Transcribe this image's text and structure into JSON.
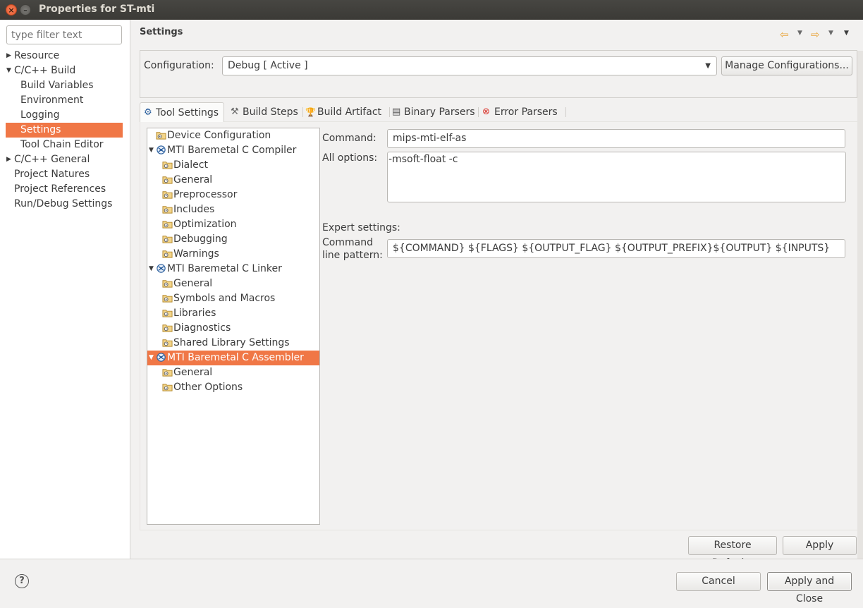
{
  "window": {
    "title": "Properties for ST-mti"
  },
  "left": {
    "filter_placeholder": "type filter text",
    "nav": [
      {
        "label": "Resource",
        "level": 0,
        "arrow": "▶"
      },
      {
        "label": "C/C++ Build",
        "level": 0,
        "arrow": "▼"
      },
      {
        "label": "Build Variables",
        "level": 1
      },
      {
        "label": "Environment",
        "level": 1
      },
      {
        "label": "Logging",
        "level": 1
      },
      {
        "label": "Settings",
        "level": 1,
        "selected": true
      },
      {
        "label": "Tool Chain Editor",
        "level": 1
      },
      {
        "label": "C/C++ General",
        "level": 0,
        "arrow": "▶"
      },
      {
        "label": "Project Natures",
        "level": 0
      },
      {
        "label": "Project References",
        "level": 0
      },
      {
        "label": "Run/Debug Settings",
        "level": 0
      }
    ]
  },
  "page": {
    "title": "Settings",
    "configuration_label": "Configuration:",
    "configuration_value": "Debug  [ Active ]",
    "manage_button": "Manage Configurations..."
  },
  "tabs": [
    {
      "label": "Tool Settings",
      "icon": "tool-settings-icon",
      "glyph": "⚙"
    },
    {
      "label": "Build Steps",
      "icon": "build-steps-icon",
      "glyph": "⚒"
    },
    {
      "label": "Build Artifact",
      "icon": "build-artifact-icon",
      "glyph": "🏆"
    },
    {
      "label": "Binary Parsers",
      "icon": "binary-parsers-icon",
      "glyph": "▤"
    },
    {
      "label": "Error Parsers",
      "icon": "error-parsers-icon",
      "glyph": "⊗"
    }
  ],
  "tree": [
    {
      "label": "Device Configuration",
      "indent": 1,
      "icon": "folder-settings"
    },
    {
      "label": "MTI Baremetal C Compiler",
      "indent": 0,
      "icon": "tool",
      "arrow": "▼"
    },
    {
      "label": "Dialect",
      "indent": 2,
      "icon": "folder-settings"
    },
    {
      "label": "General",
      "indent": 2,
      "icon": "folder-settings"
    },
    {
      "label": "Preprocessor",
      "indent": 2,
      "icon": "folder-settings"
    },
    {
      "label": "Includes",
      "indent": 2,
      "icon": "folder-settings"
    },
    {
      "label": "Optimization",
      "indent": 2,
      "icon": "folder-settings"
    },
    {
      "label": "Debugging",
      "indent": 2,
      "icon": "folder-settings"
    },
    {
      "label": "Warnings",
      "indent": 2,
      "icon": "folder-settings"
    },
    {
      "label": "MTI Baremetal C Linker",
      "indent": 0,
      "icon": "tool",
      "arrow": "▼"
    },
    {
      "label": "General",
      "indent": 2,
      "icon": "folder-settings"
    },
    {
      "label": "Symbols and Macros",
      "indent": 2,
      "icon": "folder-settings"
    },
    {
      "label": "Libraries",
      "indent": 2,
      "icon": "folder-settings"
    },
    {
      "label": "Diagnostics",
      "indent": 2,
      "icon": "folder-settings"
    },
    {
      "label": "Shared Library Settings",
      "indent": 2,
      "icon": "folder-settings"
    },
    {
      "label": "MTI Baremetal C Assembler",
      "indent": 0,
      "icon": "tool",
      "arrow": "▼",
      "selected": true
    },
    {
      "label": "General",
      "indent": 2,
      "icon": "folder-settings"
    },
    {
      "label": "Other Options",
      "indent": 2,
      "icon": "folder-settings"
    }
  ],
  "options": {
    "command_label": "Command:",
    "command_value": "mips-mti-elf-as",
    "all_options_label": "All options:",
    "all_options_value": "-msoft-float -c",
    "expert_label": "Expert settings:",
    "pattern_label_1": "Command",
    "pattern_label_2": "line pattern:",
    "pattern_value": "${COMMAND} ${FLAGS} ${OUTPUT_FLAG} ${OUTPUT_PREFIX}${OUTPUT} ${INPUTS}"
  },
  "buttons": {
    "restore_defaults": "Restore Defaults",
    "apply": "Apply",
    "cancel": "Cancel",
    "apply_and_close": "Apply and Close",
    "help_glyph": "?"
  },
  "colors": {
    "selection": "#f07746",
    "titlebar": "#3b3a36",
    "close": "#e4572e"
  }
}
